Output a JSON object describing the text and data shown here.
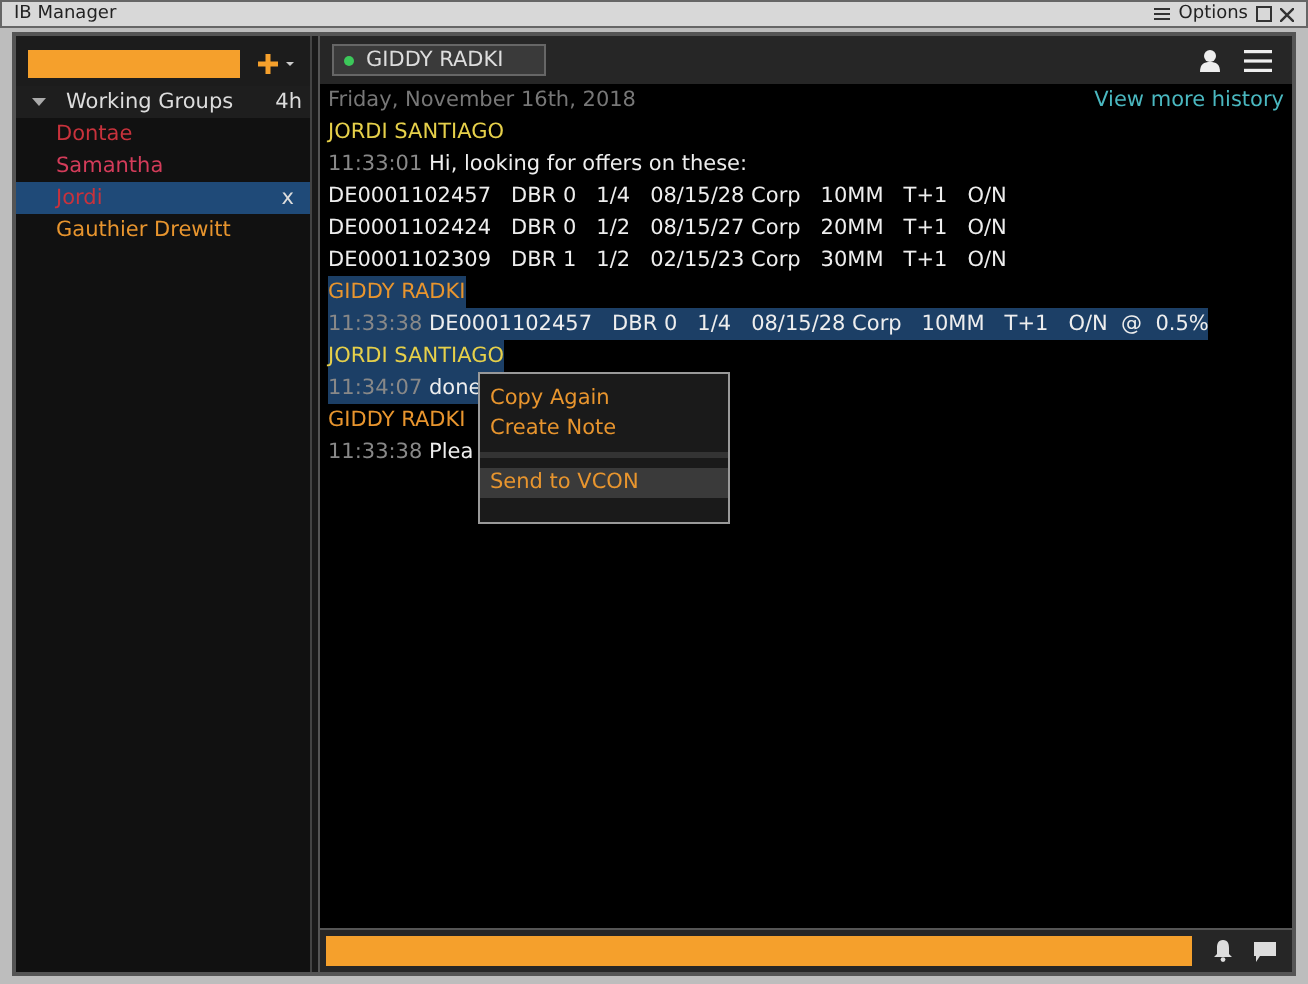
{
  "window": {
    "title": "IB Manager",
    "options": "Options"
  },
  "sidebar": {
    "header": "Working Groups",
    "header_time": "4h",
    "expanded": true,
    "items": [
      {
        "label": "Dontae",
        "color": "#c8323c",
        "selected": false
      },
      {
        "label": "Samantha",
        "color": "#d43c5a",
        "selected": false
      },
      {
        "label": "Jordi",
        "color": "#c8323c",
        "selected": true,
        "close": "x"
      },
      {
        "label": "Gauthier Drewitt",
        "color": "#e8952e",
        "selected": false
      }
    ]
  },
  "chat": {
    "tab": "GIDDY RADKI",
    "online": true,
    "date": "Friday, November 16th, 2018",
    "history_link": "View more history",
    "messages": [
      {
        "kind": "sender",
        "text": "JORDI SANTIAGO",
        "color": "#e6d04a",
        "selected": false
      },
      {
        "kind": "line",
        "time": "11:33:01",
        "text": "Hi, looking for offers on these:",
        "selected": false
      },
      {
        "kind": "line",
        "text": "DE0001102457   DBR 0   1/4   08/15/28 Corp   10MM   T+1   O/N",
        "selected": false
      },
      {
        "kind": "line",
        "text": "DE0001102424   DBR 0   1/2   08/15/27 Corp   20MM   T+1   O/N",
        "selected": false
      },
      {
        "kind": "line",
        "text": "DE0001102309   DBR 1   1/2   02/15/23 Corp   30MM   T+1   O/N",
        "selected": false
      },
      {
        "kind": "sender",
        "text": "GIDDY RADKI",
        "color": "#e8952e",
        "selected": true
      },
      {
        "kind": "line",
        "time": "11:33:38",
        "text": "DE0001102457   DBR 0   1/4   08/15/28 Corp   10MM   T+1   O/N  @  0.5%",
        "selected": true
      },
      {
        "kind": "sender",
        "text": "JORDI SANTIAGO",
        "color": "#e6d04a",
        "selected": true
      },
      {
        "kind": "line",
        "time": "11:34:07",
        "text": "done",
        "selected": true
      },
      {
        "kind": "sender",
        "text": "GIDDY RADKI",
        "color": "#e8952e",
        "selected": false
      },
      {
        "kind": "line",
        "time": "11:33:38",
        "text": "Plea",
        "selected": false
      }
    ]
  },
  "context_menu": [
    {
      "label": "Copy Again",
      "selected": false
    },
    {
      "label": "Create Note",
      "selected": false
    },
    {
      "label": "Send to VCON",
      "selected": true,
      "separator_before": true
    }
  ]
}
